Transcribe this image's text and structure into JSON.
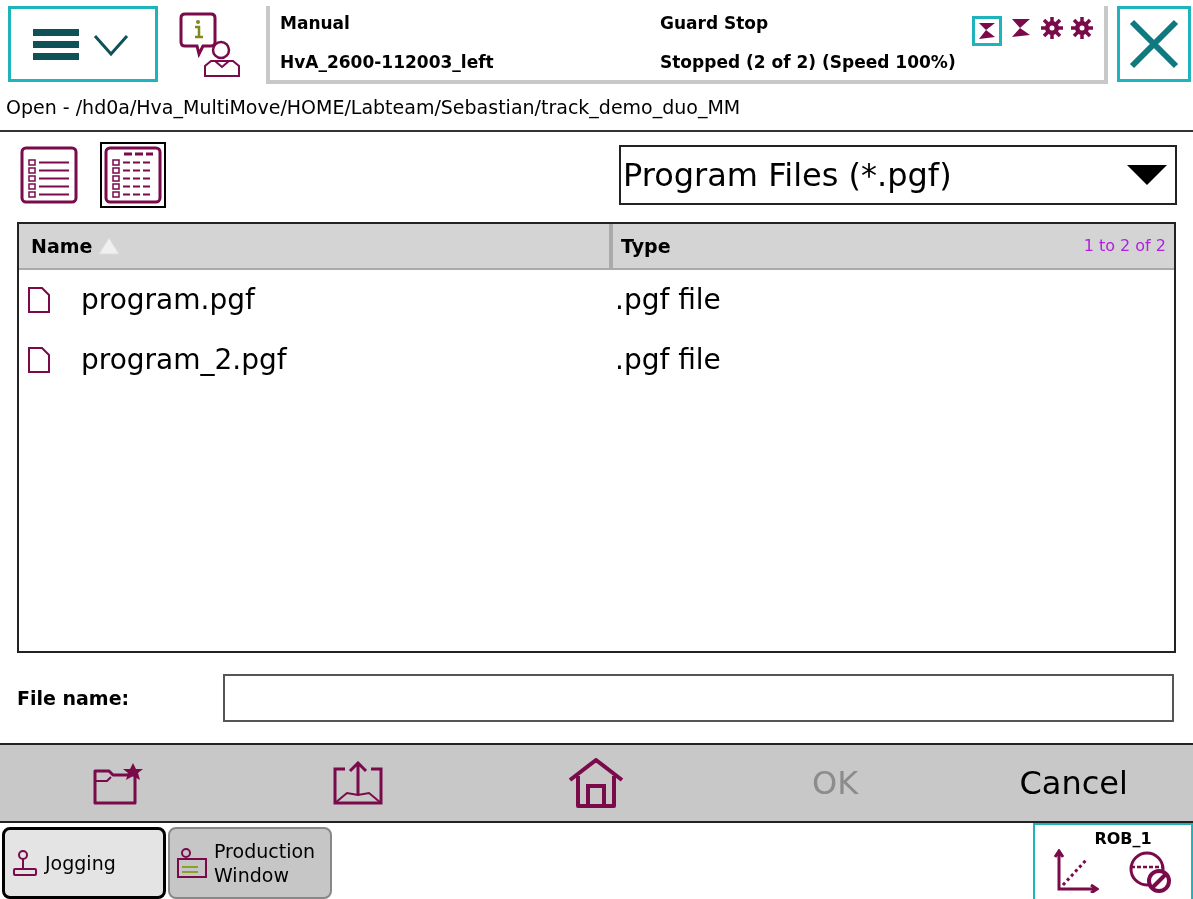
{
  "header": {
    "mode": "Manual",
    "controller": "HvA_2600-112003_left",
    "safety": "Guard Stop",
    "status": "Stopped (2 of 2) (Speed 100%)"
  },
  "title": "Open - /hd0a/Hva_MultiMove/HOME/Labteam/Sebastian/track_demo_duo_MM",
  "views": [
    {
      "kind": "list",
      "selected": false
    },
    {
      "kind": "details",
      "selected": true
    }
  ],
  "filter": {
    "value": "Program Files (*.pgf)"
  },
  "table": {
    "columns": [
      "Name",
      "Type"
    ],
    "count": "1 to 2 of 2",
    "rows": [
      {
        "name": "program.pgf",
        "type": ".pgf file"
      },
      {
        "name": "program_2.pgf",
        "type": ".pgf file"
      }
    ]
  },
  "file_name": {
    "label": "File name:"
  },
  "actions": [
    {
      "kind": "new-folder"
    },
    {
      "kind": "up"
    },
    {
      "kind": "home"
    },
    {
      "kind": "text",
      "label": "OK",
      "disabled": true
    },
    {
      "kind": "text",
      "label": "Cancel",
      "disabled": false
    }
  ],
  "taskbar": [
    {
      "label": "Jogging",
      "kind": "jog",
      "selected": true
    },
    {
      "label": "Production\nWindow",
      "kind": "production",
      "selected": false
    }
  ],
  "robot": {
    "label": "ROB_1"
  }
}
